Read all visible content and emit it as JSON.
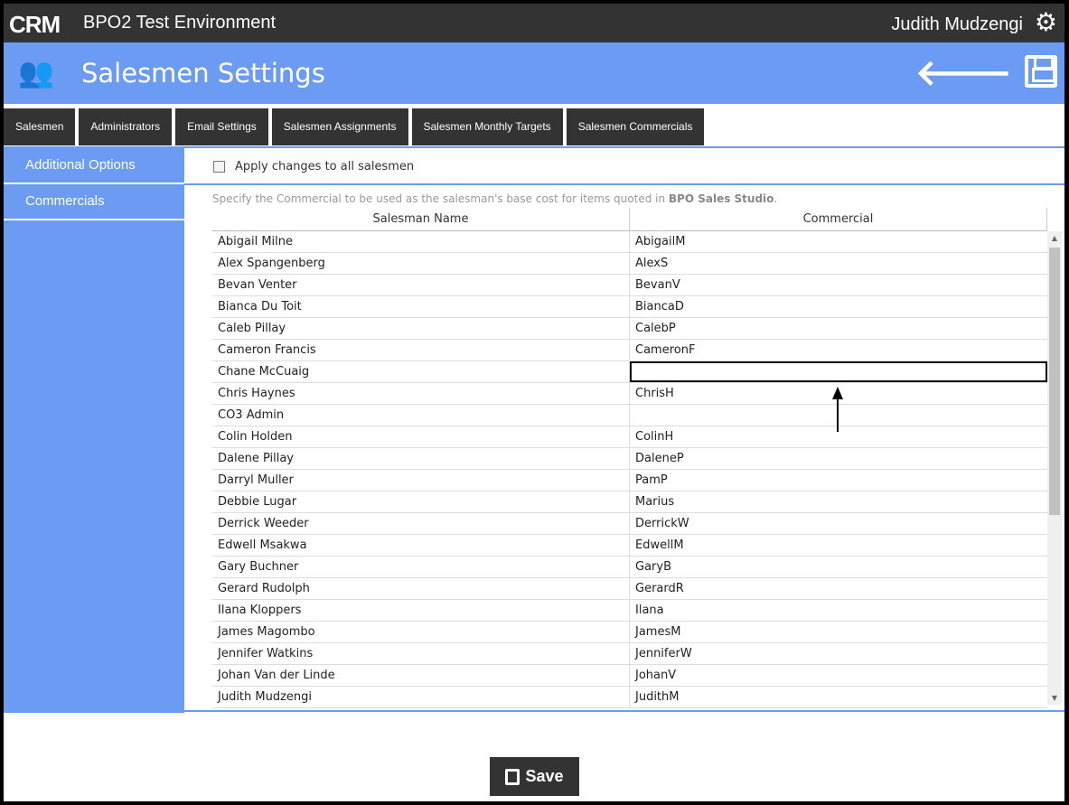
{
  "topbar": {
    "logo": "CRM",
    "environment": "BPO2 Test Environment",
    "user": "Judith Mudzengi"
  },
  "header": {
    "title": "Salesmen Settings"
  },
  "tabs": [
    "Salesmen",
    "Administrators",
    "Email Settings",
    "Salesmen Assignments",
    "Salesmen Monthly Targets",
    "Salesmen Commercials"
  ],
  "sidebar": [
    "Additional Options",
    "Commercials"
  ],
  "options": {
    "apply_all": "Apply changes to all salesmen"
  },
  "note": {
    "text": "Specify the Commercial to be used as the salesman's base cost for items quoted in ",
    "product": "BPO Sales Studio",
    "end": "."
  },
  "table": {
    "columns": [
      "Salesman Name",
      "Commercial"
    ],
    "rows": [
      [
        "Abigail Milne",
        "AbigailM"
      ],
      [
        "Alex Spangenberg",
        "AlexS"
      ],
      [
        "Bevan Venter",
        "BevanV"
      ],
      [
        "Bianca Du Toit",
        "BiancaD"
      ],
      [
        "Caleb Pillay",
        "CalebP"
      ],
      [
        "Cameron Francis",
        "CameronF"
      ],
      [
        "Chane McCuaig",
        ""
      ],
      [
        "Chris Haynes",
        "ChrisH"
      ],
      [
        "CO3 Admin",
        ""
      ],
      [
        "Colin Holden",
        "ColinH"
      ],
      [
        "Dalene Pillay",
        "DaleneP"
      ],
      [
        "Darryl Muller",
        "PamP"
      ],
      [
        "Debbie Lugar",
        "Marius"
      ],
      [
        "Derrick Weeder",
        "DerrickW"
      ],
      [
        "Edwell Msakwa",
        "EdwellM"
      ],
      [
        "Gary Buchner",
        "GaryB"
      ],
      [
        "Gerard Rudolph",
        "GerardR"
      ],
      [
        "Ilana Kloppers",
        "Ilana"
      ],
      [
        "James Magombo",
        "JamesM"
      ],
      [
        "Jennifer Watkins",
        "JenniferW"
      ],
      [
        "Johan Van der Linde",
        "JohanV"
      ],
      [
        "Judith Mudzengi",
        "JudithM"
      ]
    ],
    "selected_row": 6
  },
  "footer": {
    "save": "Save"
  }
}
